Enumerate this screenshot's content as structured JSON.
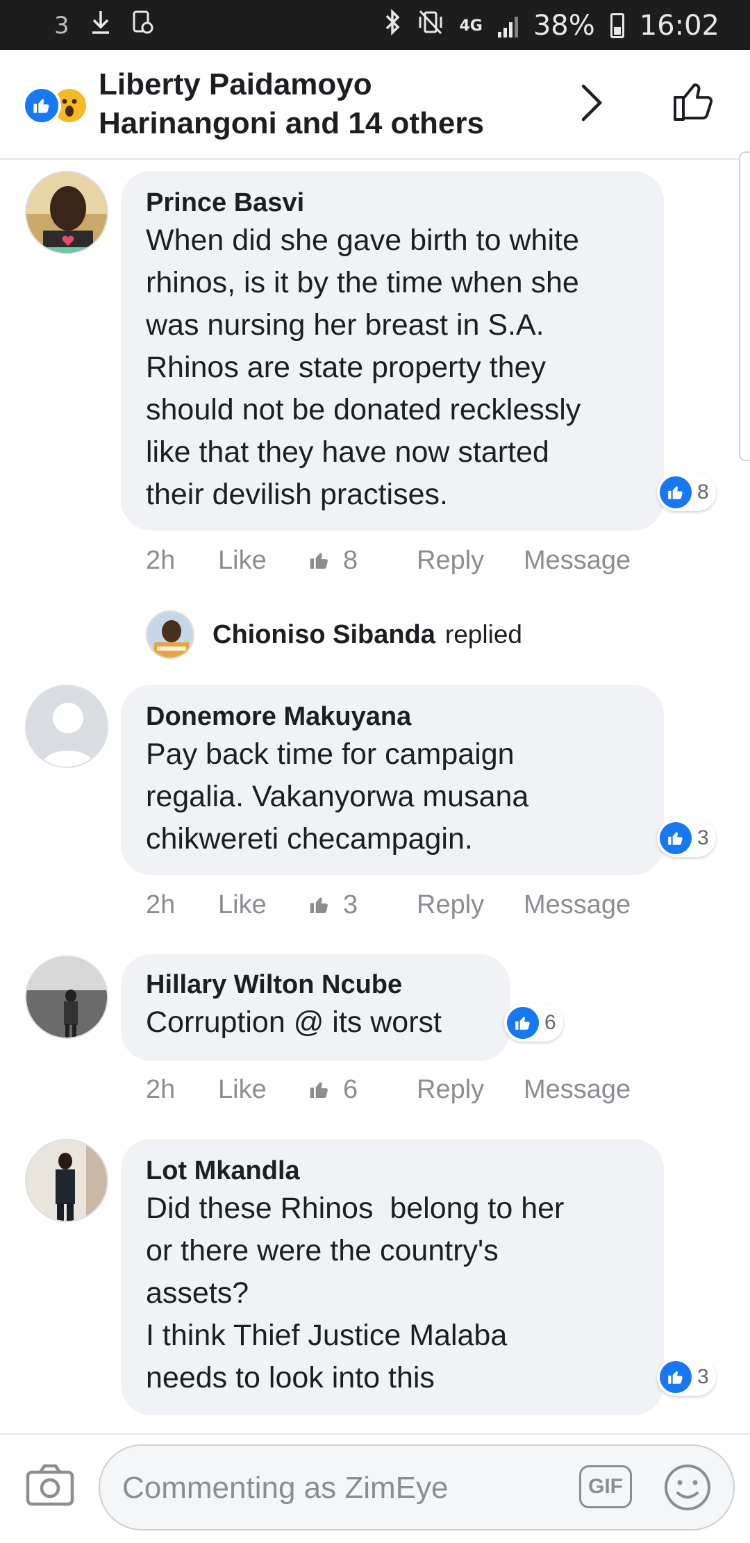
{
  "status_bar": {
    "carrier_icon": "3",
    "network": "4G",
    "battery": "38%",
    "time": "16:02"
  },
  "header": {
    "title": "Liberty Paidamoyo Harinangoni and 14 others",
    "reactions": [
      "like",
      "wow"
    ]
  },
  "comments": [
    {
      "author": "Prince Basvi",
      "lines": [
        "When did she gave birth to white",
        "rhinos, is it by the time when she",
        "was nursing her breast in S.A.",
        "Rhinos are state property they",
        "should not be donated recklessly",
        "like that they have now started",
        "their devilish practises."
      ],
      "likes": "8",
      "time": "2h",
      "like_label": "Like",
      "reply_label": "Reply",
      "message_label": "Message"
    },
    {
      "author": "Donemore Makuyana",
      "lines": [
        "Pay back time for campaign",
        "regalia. Vakanyorwa musana",
        "chikwereti checampagin."
      ],
      "likes": "3",
      "time": "2h",
      "like_label": "Like",
      "reply_label": "Reply",
      "message_label": "Message"
    },
    {
      "author": "Hillary Wilton Ncube",
      "lines": [
        "Corruption @ its worst"
      ],
      "likes": "6",
      "time": "2h",
      "like_label": "Like",
      "reply_label": "Reply",
      "message_label": "Message"
    },
    {
      "author": "Lot Mkandla",
      "lines": [
        "Did these Rhinos  belong to her",
        "or there were the country's",
        "assets?",
        "I think Thief Justice Malaba",
        "needs to look into this"
      ],
      "likes": "3"
    }
  ],
  "reply_notice": {
    "name": "Chioniso Sibanda",
    "word": "replied"
  },
  "composer": {
    "placeholder": "Commenting as ZimEye",
    "gif_label": "GIF"
  },
  "colors": {
    "accent": "#1877f2",
    "bubble": "#f0f2f5",
    "muted": "#8a8d91"
  }
}
